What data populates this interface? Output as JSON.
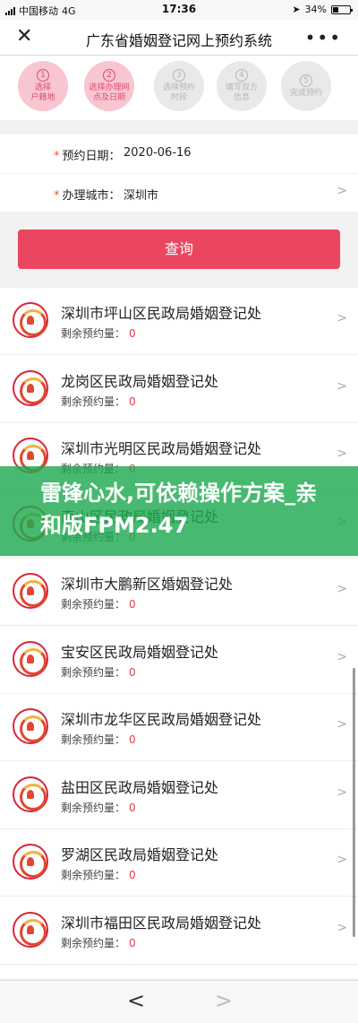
{
  "status_bar": {
    "carrier": "中国移动",
    "network": "4G",
    "time": "17:36",
    "battery_text": "34%",
    "battery_level": 0.34
  },
  "nav": {
    "close_icon": "close-icon",
    "title": "广东省婚姻登记网上预约系统",
    "more_icon": "more-icon"
  },
  "steps": [
    {
      "num": "1",
      "line1": "选择",
      "line2": "户籍地",
      "active": true
    },
    {
      "num": "2",
      "line1": "选择办理网",
      "line2": "点及日期",
      "active": true
    },
    {
      "num": "3",
      "line1": "选择预约",
      "line2": "时段",
      "active": false
    },
    {
      "num": "4",
      "line1": "填写双方",
      "line2": "信息",
      "active": false
    },
    {
      "num": "5",
      "line1": "完成预约",
      "line2": "",
      "active": false
    }
  ],
  "form": {
    "date_label": "预约日期：",
    "date_value": "2020-06-16",
    "city_label": "办理城市：",
    "city_value": "深圳市"
  },
  "query_button": "查询",
  "remain_label": "剩余预约量：",
  "offices": [
    {
      "name": "深圳市坪山区民政局婚姻登记处",
      "remain": "0"
    },
    {
      "name": "龙岗区民政局婚姻登记处",
      "remain": "0"
    },
    {
      "name": "深圳市光明区民政局婚姻登记处",
      "remain": "0"
    },
    {
      "name": "南山区民政局婚姻登记处",
      "remain": "0"
    },
    {
      "name": "深圳市大鹏新区婚姻登记处",
      "remain": "0"
    },
    {
      "name": "宝安区民政局婚姻登记处",
      "remain": "0"
    },
    {
      "name": "深圳市龙华区民政局婚姻登记处",
      "remain": "0"
    },
    {
      "name": "盐田区民政局婚姻登记处",
      "remain": "0"
    },
    {
      "name": "罗湖区民政局婚姻登记处",
      "remain": "0"
    },
    {
      "name": "深圳市福田区民政局婚姻登记处",
      "remain": "0"
    }
  ],
  "banner": {
    "text": "雷锋心水,可依赖操作方案_亲和版FPM2.47"
  },
  "bottom_nav": {
    "back_icon": "chevron-left-icon",
    "forward_icon": "chevron-right-icon"
  },
  "colors": {
    "accent": "#eb4660",
    "step_active_bg": "#f7c6d1",
    "banner_green": "#20aa50"
  }
}
